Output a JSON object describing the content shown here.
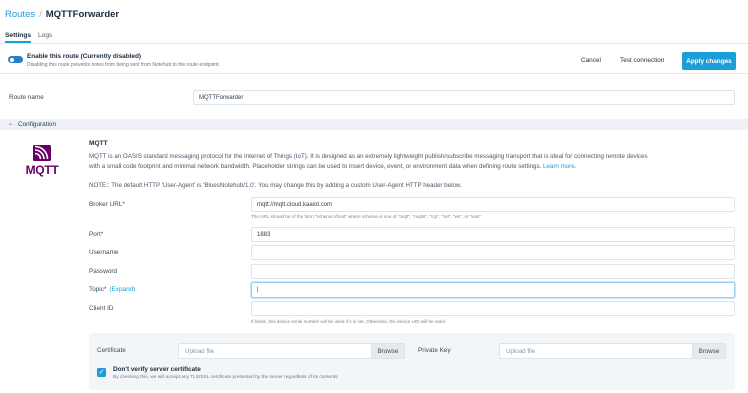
{
  "breadcrumb": {
    "root": "Routes",
    "separator": "/",
    "current": "MQTTForwarder"
  },
  "tabs": [
    {
      "label": "Settings",
      "active": true
    },
    {
      "label": "Logs",
      "active": false
    }
  ],
  "enable": {
    "title": "Enable this route (Currently disabled)",
    "description": "Disabling this route prevents notes from being sent from Notehub to the route endpoint."
  },
  "actions": {
    "cancel": "Cancel",
    "test": "Test connection",
    "apply": "Apply changes"
  },
  "route_name": {
    "label": "Route name",
    "value": "MQTTForwarder"
  },
  "section": {
    "title": "Configuration"
  },
  "mqtt": {
    "logo_text": "MQTT",
    "title": "MQTT",
    "desc_line1": "MQTT is an OASIS standard messaging protocol for the Internet of Things (IoT). It is designed as an extremely lightweight publish/subscribe messaging transport that is ideal for connecting remote devices",
    "desc_line2": "with a small code footprint and minimal network bandwidth. Placeholder strings can be used to insert device, event, or environment data when defining route settings.",
    "learn_more": "Learn more.",
    "note": "NOTE:: The default HTTP 'User-Agent' is 'BluesNotehub/1.0'. You may change this by adding a custom User-Agent HTTP header below."
  },
  "fields": {
    "broker": {
      "label": "Broker URL*",
      "value": "mqtt://mqtt.cloud.kaaiot.com",
      "hint": "The URL should be of the form \"scheme://host\" where scheme is one of \"mqtt\", \"mqtts\", \"tcp\", \"ssl\", \"ws\", or \"wss\"."
    },
    "port": {
      "label": "Port*",
      "value": "1883"
    },
    "username": {
      "label": "Username",
      "value": ""
    },
    "password": {
      "label": "Password",
      "value": ""
    },
    "topic": {
      "label": "Topic*",
      "expand": "(Expand)",
      "value": "|"
    },
    "client_id": {
      "label": "Client ID",
      "value": "",
      "hint": "If blank, this device serial number will be used if it is set. Otherwise, the device UID will be used."
    }
  },
  "certs": {
    "certificate_label": "Certificate",
    "private_key_label": "Private Key",
    "upload_placeholder": "Upload file",
    "browse": "Browse",
    "verify_title": "Don't verify server certificate",
    "verify_desc": "By checking this, we will accept any TLS/SSL certificate presented by the server regardless of its contents.",
    "verify_checked": true
  },
  "colors": {
    "accent": "#1e9ed8",
    "toggle": "#2b7fc5",
    "mqtt_brand": "#660066"
  }
}
